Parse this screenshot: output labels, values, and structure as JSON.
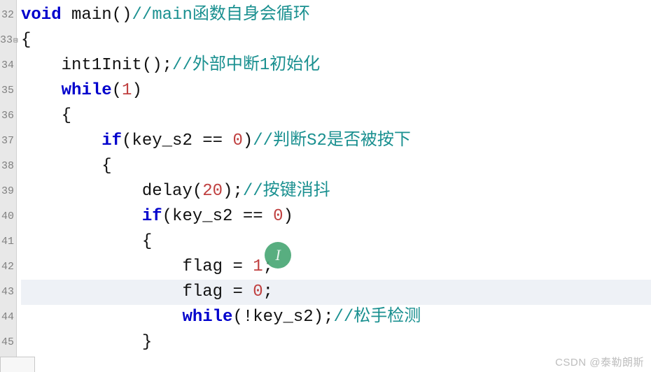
{
  "gutter": {
    "start": 32,
    "end": 45,
    "fold_line": 33
  },
  "code_lines": [
    {
      "n": 32,
      "indent": 0,
      "hl": false,
      "segs": [
        {
          "c": "kw",
          "t": "void"
        },
        {
          "c": "txt",
          "t": " "
        },
        {
          "c": "fn",
          "t": "main"
        },
        {
          "c": "txt",
          "t": "()"
        },
        {
          "c": "cmt",
          "t": "//main函数自身会循环"
        }
      ]
    },
    {
      "n": 33,
      "indent": 0,
      "hl": false,
      "segs": [
        {
          "c": "txt",
          "t": "{"
        }
      ]
    },
    {
      "n": 34,
      "indent": 1,
      "hl": false,
      "segs": [
        {
          "c": "fn",
          "t": "int1Init"
        },
        {
          "c": "txt",
          "t": "();"
        },
        {
          "c": "cmt",
          "t": "//外部中断1初始化"
        }
      ]
    },
    {
      "n": 35,
      "indent": 1,
      "hl": false,
      "segs": [
        {
          "c": "kw",
          "t": "while"
        },
        {
          "c": "txt",
          "t": "("
        },
        {
          "c": "num",
          "t": "1"
        },
        {
          "c": "txt",
          "t": ")"
        }
      ]
    },
    {
      "n": 36,
      "indent": 1,
      "hl": false,
      "segs": [
        {
          "c": "txt",
          "t": "{"
        }
      ]
    },
    {
      "n": 37,
      "indent": 2,
      "hl": false,
      "segs": [
        {
          "c": "kw",
          "t": "if"
        },
        {
          "c": "txt",
          "t": "(key_s2 "
        },
        {
          "c": "op",
          "t": "=="
        },
        {
          "c": "txt",
          "t": " "
        },
        {
          "c": "num",
          "t": "0"
        },
        {
          "c": "txt",
          "t": ")"
        },
        {
          "c": "cmt",
          "t": "//判断S2是否被按下"
        }
      ]
    },
    {
      "n": 38,
      "indent": 2,
      "hl": false,
      "segs": [
        {
          "c": "txt",
          "t": "{"
        }
      ]
    },
    {
      "n": 39,
      "indent": 3,
      "hl": false,
      "segs": [
        {
          "c": "fn",
          "t": "delay"
        },
        {
          "c": "txt",
          "t": "("
        },
        {
          "c": "num",
          "t": "20"
        },
        {
          "c": "txt",
          "t": ");"
        },
        {
          "c": "cmt",
          "t": "//按键消抖"
        }
      ]
    },
    {
      "n": 40,
      "indent": 3,
      "hl": false,
      "segs": [
        {
          "c": "kw",
          "t": "if"
        },
        {
          "c": "txt",
          "t": "(key_s2 "
        },
        {
          "c": "op",
          "t": "=="
        },
        {
          "c": "txt",
          "t": " "
        },
        {
          "c": "num",
          "t": "0"
        },
        {
          "c": "txt",
          "t": ")"
        }
      ]
    },
    {
      "n": 41,
      "indent": 3,
      "hl": false,
      "segs": [
        {
          "c": "txt",
          "t": "{"
        }
      ]
    },
    {
      "n": 42,
      "indent": 4,
      "hl": false,
      "segs": [
        {
          "c": "txt",
          "t": "flag "
        },
        {
          "c": "op",
          "t": "="
        },
        {
          "c": "txt",
          "t": " "
        },
        {
          "c": "num",
          "t": "1"
        },
        {
          "c": "txt",
          "t": ";"
        }
      ]
    },
    {
      "n": 43,
      "indent": 4,
      "hl": true,
      "segs": [
        {
          "c": "txt",
          "t": "flag "
        },
        {
          "c": "op",
          "t": "="
        },
        {
          "c": "txt",
          "t": " "
        },
        {
          "c": "num",
          "t": "0"
        },
        {
          "c": "txt",
          "t": ";"
        }
      ]
    },
    {
      "n": 44,
      "indent": 4,
      "hl": false,
      "segs": [
        {
          "c": "kw",
          "t": "while"
        },
        {
          "c": "txt",
          "t": "(!key_s2);"
        },
        {
          "c": "cmt",
          "t": "//松手检测"
        }
      ]
    },
    {
      "n": 45,
      "indent": 3,
      "hl": false,
      "segs": [
        {
          "c": "txt",
          "t": "}"
        }
      ]
    }
  ],
  "cursor_badge": "I",
  "watermark": "CSDN @泰勒朗斯"
}
